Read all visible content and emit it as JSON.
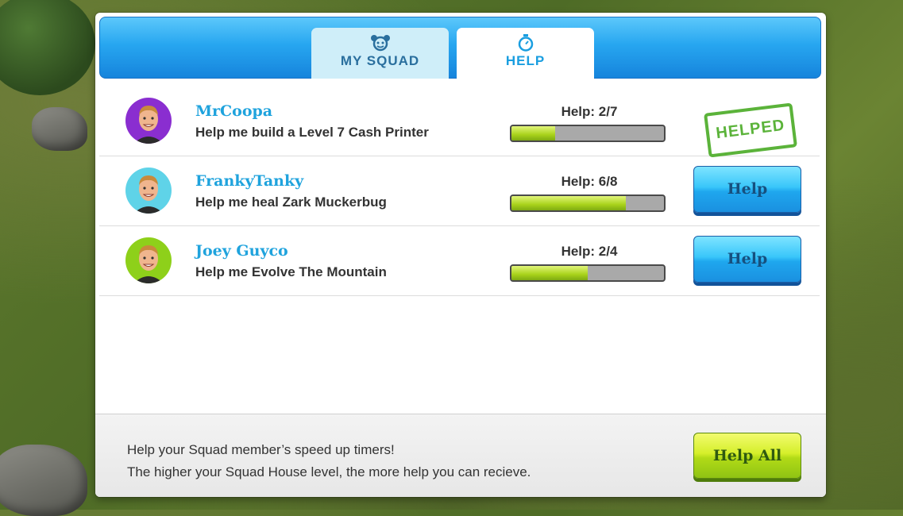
{
  "tabs": [
    {
      "label": "MY SQUAD",
      "icon": "squad-icon",
      "active": false
    },
    {
      "label": "HELP",
      "icon": "stopwatch-icon",
      "active": true
    }
  ],
  "requests": [
    {
      "name": "MrCoopa",
      "request": "Help me build a Level 7 Cash Printer",
      "help_label": "Help:",
      "help_value": "2/7",
      "progress": 0.2857,
      "status": "helped",
      "status_label": "HELPED",
      "avatar_bg": "#8a2ed0"
    },
    {
      "name": "FrankyTanky",
      "request": "Help me heal Zark Muckerbug",
      "help_label": "Help:",
      "help_value": "6/8",
      "progress": 0.75,
      "status": "open",
      "button_label": "Help",
      "avatar_bg": "#5fd3e8"
    },
    {
      "name": "Joey Guyco",
      "request": "Help me Evolve The Mountain",
      "help_label": "Help:",
      "help_value": "2/4",
      "progress": 0.5,
      "status": "open",
      "button_label": "Help",
      "avatar_bg": "#8ed01a"
    }
  ],
  "footer": {
    "line1": "Help your Squad member’s speed up timers!",
    "line2": "The higher your Squad House level, the more help you can recieve.",
    "help_all_label": "Help All"
  },
  "colors": {
    "accent": "#1fa3dd",
    "progress_fill": "#a8d21a",
    "helped_stamp": "#5bb33a",
    "header": "#27a6f0"
  }
}
